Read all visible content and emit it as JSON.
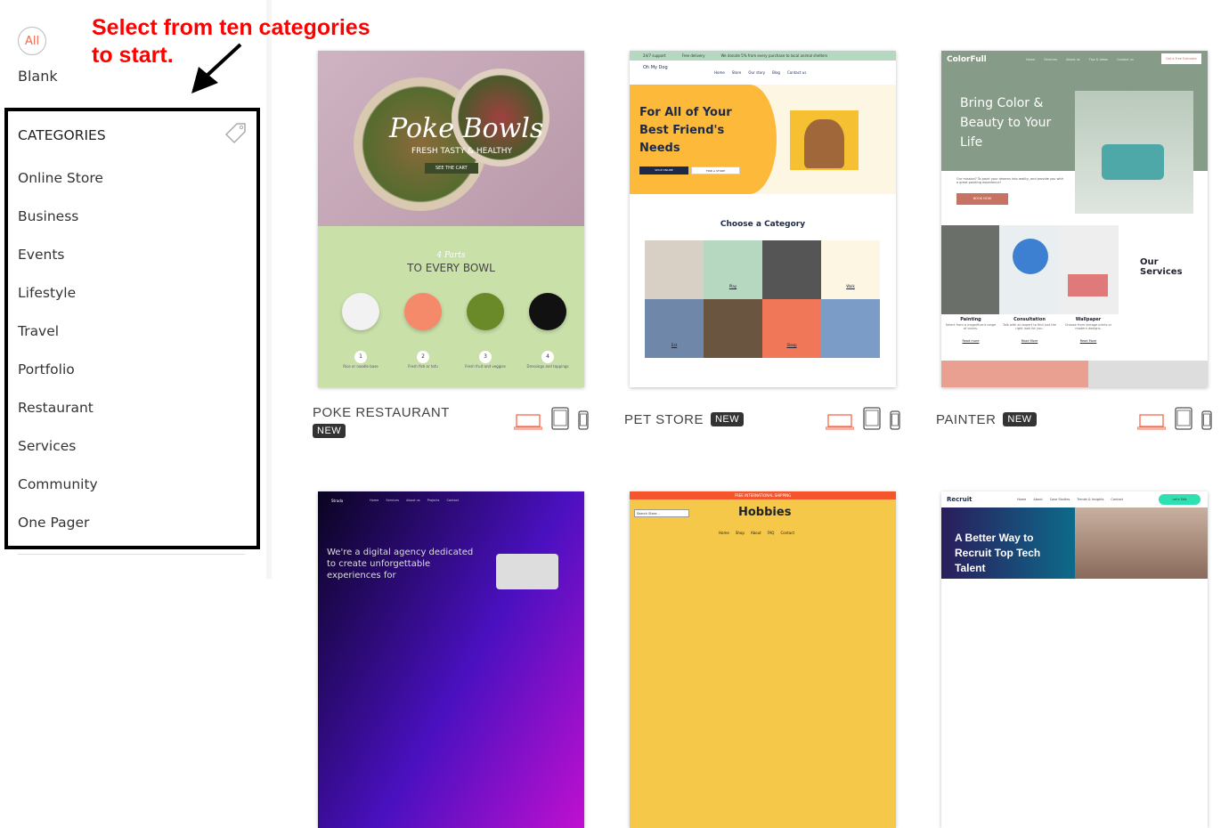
{
  "sidebar": {
    "all_label": "All",
    "blank_label": "Blank",
    "categories_title": "CATEGORIES",
    "categories": [
      "Online Store",
      "Business",
      "Events",
      "Lifestyle",
      "Travel",
      "Portfolio",
      "Restaurant",
      "Services",
      "Community",
      "One Pager"
    ]
  },
  "annotation": {
    "line1": "Select from ten categories",
    "line2": "to start."
  },
  "colors": {
    "annotation": "#ff0000",
    "accent": "#f46a4b",
    "badge": "#333333"
  },
  "templates": [
    {
      "name": "POKE RESTAURANT",
      "badge": "NEW",
      "hero_title": "Poke Bowls",
      "hero_sub": "FRESH TASTY & HEALTHY",
      "cta": "SEE THE CART",
      "section_small": "4 Parts",
      "section_title": "TO EVERY BOWL",
      "steps": [
        "Rice or noodle base",
        "Fresh fish or tofu",
        "Fresh fruit and veggies",
        "Dressings and toppings"
      ]
    },
    {
      "name": "PET STORE",
      "badge": "NEW",
      "topbar": [
        "24/7 support",
        "Free delivery",
        "We donate 5% from every purchase to local animal shelters"
      ],
      "logo": "Oh My Dog",
      "nav": [
        "Home",
        "Store",
        "Our story",
        "Blog",
        "Contact us"
      ],
      "hero_title": "For All of Your Best Friend's Needs",
      "btn1": "SHOP ONLINE",
      "btn2": "FIND A STORE",
      "section_title": "Choose a Category",
      "tiles": [
        "Play",
        "Walk",
        "Eat",
        "Sleep"
      ]
    },
    {
      "name": "PAINTER",
      "badge": "NEW",
      "logo": "ColorFull",
      "nav": [
        "Home",
        "Services",
        "About us",
        "Tips & Ideas",
        "Contact us"
      ],
      "cta": "Get a Free Estimate",
      "hero_title": "Bring Color & Beauty to Your Life",
      "mission": "Our mission? To paint your dreams into reality, and provide you with a great painting experience!",
      "book": "BOOK NOW",
      "services_title": "Our Services",
      "services": [
        {
          "title": "Painting",
          "desc": "Select from a magnificent range of colors.",
          "link": "Read more"
        },
        {
          "title": "Consultation",
          "desc": "Talk with an expert to find just the right look for you.",
          "link": "Read More"
        },
        {
          "title": "Wallpaper",
          "desc": "Choose from vintage prints or modern designs.",
          "link": "Read More"
        }
      ]
    },
    {
      "logo": "Strada",
      "nav": [
        "Home",
        "Services",
        "About us",
        "Projects",
        "Contact"
      ],
      "hero": "We're a digital agency dedicated to create unforgettable experiences for"
    },
    {
      "topbar": "FREE INTERNATIONAL SHIPPING",
      "search": "Search Store...",
      "logo": "Hobbies",
      "nav": [
        "Home",
        "Shop",
        "About",
        "FAQ",
        "Contact"
      ]
    },
    {
      "logo": "Recruit",
      "nav": [
        "Home",
        "About",
        "Case Studies",
        "Trends & Insights",
        "Contact"
      ],
      "cta": "Let's Talk",
      "hero": "A Better Way to Recruit Top Tech Talent"
    }
  ]
}
